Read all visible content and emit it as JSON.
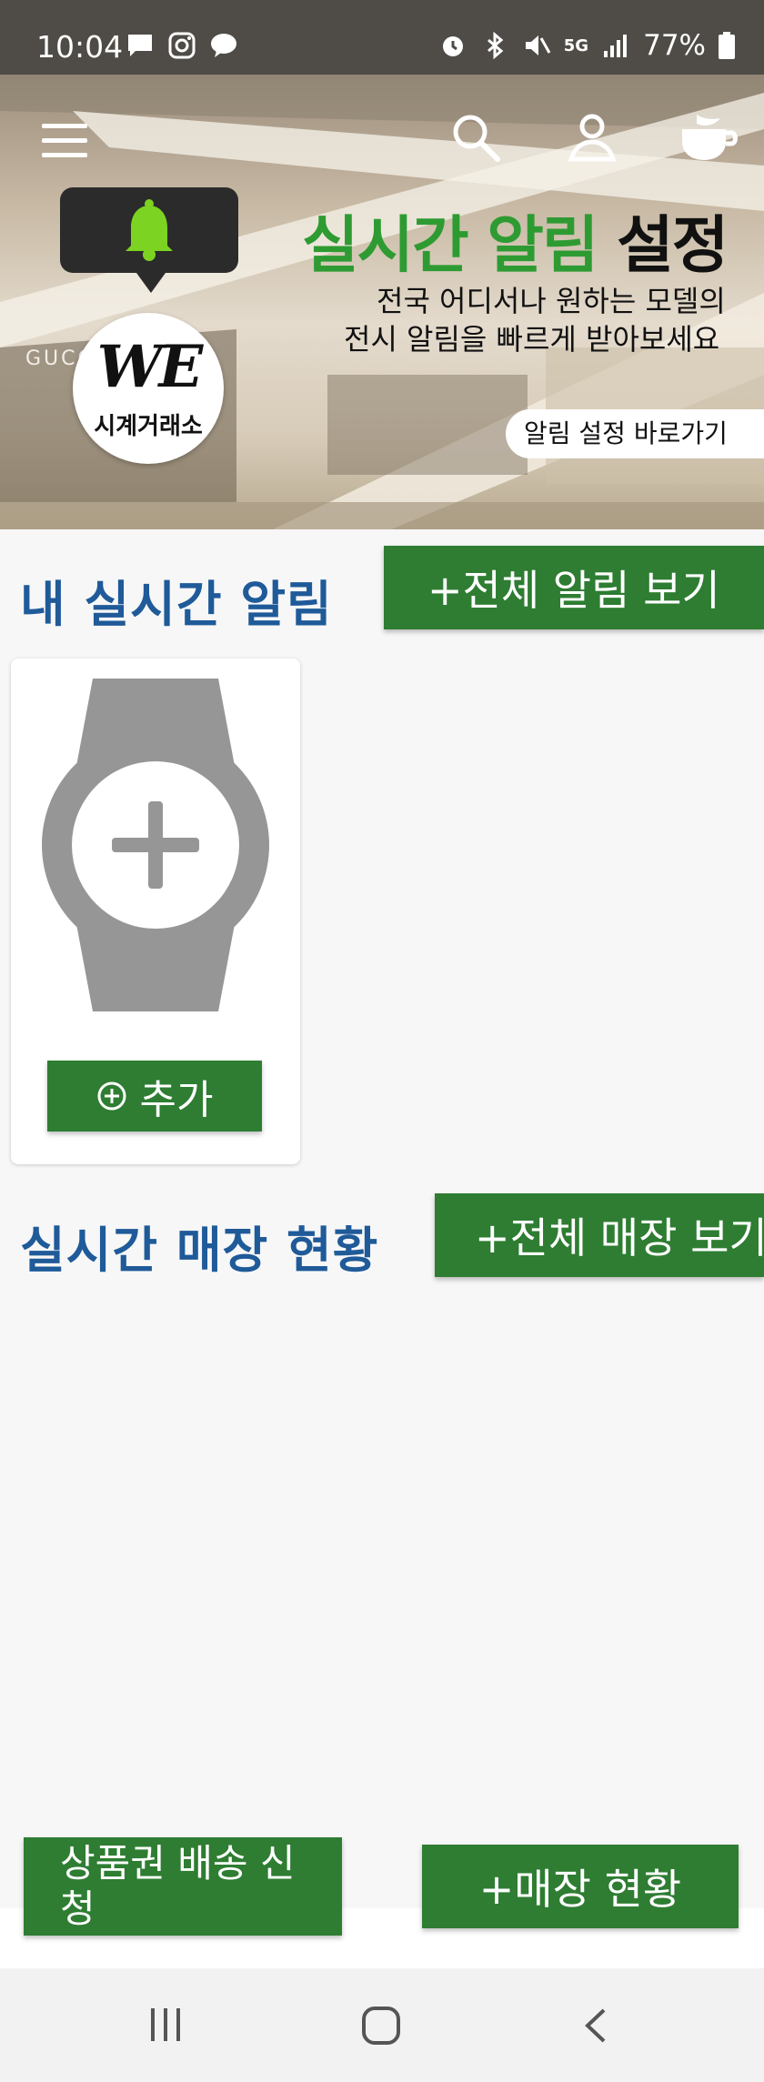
{
  "status_bar": {
    "time": "10:04",
    "network": "5G",
    "battery": "77%"
  },
  "hero": {
    "title_green": "실시간 알림",
    "title_dark": "설정",
    "subtitle_line1": "전국 어디서나 원하는 모델의",
    "subtitle_line2": "전시 알림을 빠르게 받아보세요",
    "link_label": "알림 설정  바로가기",
    "logo_mark": "WE",
    "logo_sub": "시계거래소",
    "bg_sign": "GUCC"
  },
  "alerts": {
    "title": "내 실시간 알림",
    "view_all_label": "+전체 알림 보기",
    "add_label": "추가"
  },
  "stores": {
    "title": "실시간 매장 현황",
    "view_all_label": "+전체 매장 보기"
  },
  "bottom": {
    "voucher_label": "상품권 배송 신청",
    "store_status_label": "+매장 현황"
  },
  "colors": {
    "accent_green": "#2e7d32",
    "title_blue": "#1f5a99",
    "hero_green": "#2e9b32"
  },
  "icons": [
    "menu-icon",
    "search-icon",
    "user-icon",
    "coffee-icon",
    "bell-icon",
    "watch-add-icon",
    "plus-circle-icon",
    "recent-apps-icon",
    "home-icon",
    "back-icon"
  ]
}
